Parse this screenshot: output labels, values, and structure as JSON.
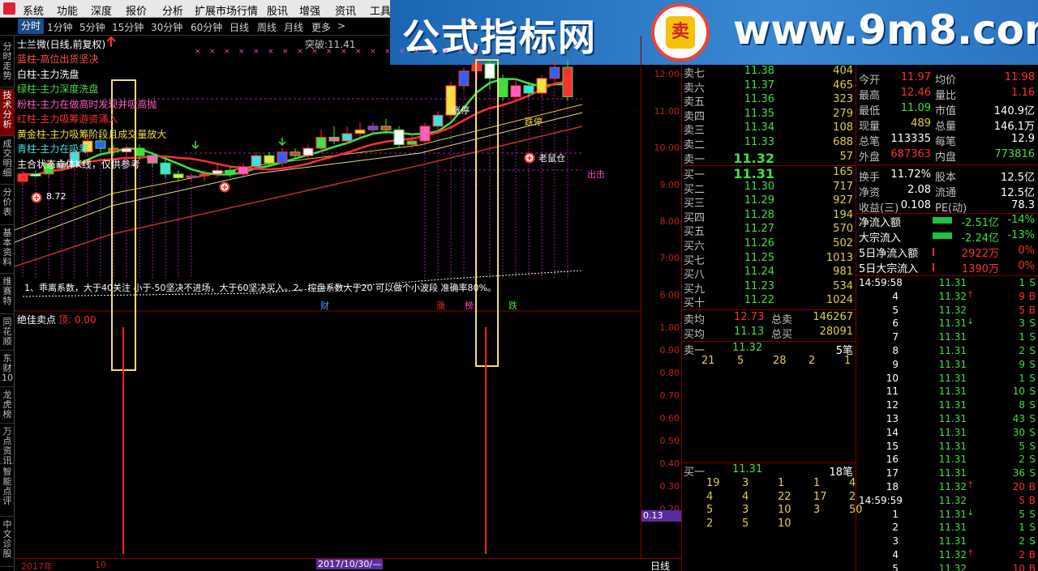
{
  "menu": [
    "系统",
    "功能",
    "深度",
    "报价",
    "分析",
    "扩展市场行情",
    "股讯",
    "增强",
    "资讯",
    "工具"
  ],
  "periods": [
    "分时",
    "1分钟",
    "5分钟",
    "15分钟",
    "30分钟",
    "60分钟",
    "日线",
    "周线",
    "月线",
    "更多"
  ],
  "periods_more_arrow": ">",
  "banner": {
    "name": "公式指标网",
    "url": "www.9m8.com",
    "seal_glyph": "卖"
  },
  "sidetabs": [
    "分时走势",
    "技术分析",
    "成交明细",
    "分价表",
    "基本资料",
    "维赛特",
    "同花顺",
    "东财10",
    "龙虎榜",
    "万点资讯",
    "智能点评",
    "中文诊股"
  ],
  "stock": {
    "title": "士兰微(日线,前复权)",
    "breakout": "突破:11.41"
  },
  "legend": [
    {
      "text": "蓝柱-高位出货坚决",
      "color": "#ff5050"
    },
    {
      "text": "白柱-主力洗盘",
      "color": "#ffffff"
    },
    {
      "text": "绿柱-主力深度洗盘",
      "color": "#40e040"
    },
    {
      "text": "粉柱-主力在做高时发现并吸高抛",
      "color": "#ff60c0"
    },
    {
      "text": "红柱-主力吸筹游资涌入",
      "color": "#ff3030"
    },
    {
      "text": "黄金柱-主力吸筹阶段且成交量放大",
      "color": "#f0e040"
    },
    {
      "text": "青柱-主力在吸筹",
      "color": "#40e0e0"
    },
    {
      "text": "主合状态立体K线，仅供参考",
      "color": "#ffffff"
    }
  ],
  "annotations": {
    "low_price": "8.72",
    "limit_up": "涨停",
    "limit_down": "跌停",
    "rat": "老鼠仓",
    "exit": "出击",
    "note": "1、乖离系数，大于40关注 小于-50坚决不进场，大于60坚决买入。2、控盘系数大于20 可以做个小波段 准确率80%。",
    "events": [
      "财",
      "涨",
      "榜",
      "跌"
    ],
    "sub_title": "绝佳卖点",
    "sub_value": "顶: 0.00",
    "sub_cursor": "0.13"
  },
  "yaxis_main": [
    "12.00",
    "11.00",
    "10.00",
    "9.00",
    "8.00",
    "7.00",
    "6.00"
  ],
  "yaxis_sub": [
    "1.00",
    "0.90",
    "0.80",
    "0.70",
    "0.60",
    "0.50",
    "0.40",
    "0.30",
    "0.20"
  ],
  "bottom": {
    "year": "2017年",
    "month": "10",
    "date": "2017/10/30/—",
    "period_label": "日线"
  },
  "chart_data": {
    "type": "candlestick",
    "title": "士兰微(日线,前复权)",
    "ylim": [
      5.8,
      12.4
    ],
    "candles": [
      [
        9.1,
        9.3,
        9.4,
        9.0
      ],
      [
        9.3,
        9.25,
        9.4,
        9.2
      ],
      [
        9.3,
        9.6,
        9.7,
        9.2
      ],
      [
        9.6,
        9.5,
        9.7,
        9.4
      ],
      [
        9.5,
        9.9,
        10.0,
        9.4
      ],
      [
        9.9,
        10.2,
        10.4,
        9.8
      ],
      [
        10.2,
        10.0,
        10.3,
        9.9
      ],
      [
        10.0,
        9.9,
        10.1,
        9.8
      ],
      [
        9.9,
        10.0,
        10.1,
        9.8
      ],
      [
        10.0,
        9.8,
        10.1,
        9.7
      ],
      [
        9.8,
        9.6,
        9.9,
        9.5
      ],
      [
        9.6,
        9.3,
        9.7,
        9.2
      ],
      [
        9.3,
        9.2,
        9.4,
        9.1
      ],
      [
        9.2,
        9.25,
        9.3,
        9.1
      ],
      [
        9.25,
        9.3,
        9.4,
        9.1
      ],
      [
        9.3,
        9.4,
        9.6,
        9.2
      ],
      [
        9.4,
        9.3,
        9.5,
        9.2
      ],
      [
        9.3,
        9.5,
        9.6,
        9.2
      ],
      [
        9.5,
        9.8,
        9.9,
        9.4
      ],
      [
        9.8,
        9.6,
        9.9,
        9.5
      ],
      [
        9.6,
        9.9,
        10.0,
        9.5
      ],
      [
        9.9,
        9.8,
        10.0,
        9.7
      ],
      [
        9.8,
        10.0,
        10.1,
        9.7
      ],
      [
        10.0,
        10.3,
        10.5,
        9.9
      ],
      [
        10.3,
        10.2,
        10.6,
        10.1
      ],
      [
        10.2,
        10.4,
        10.6,
        10.1
      ],
      [
        10.4,
        10.5,
        10.7,
        10.3
      ],
      [
        10.5,
        10.6,
        10.7,
        10.4
      ],
      [
        10.6,
        10.5,
        10.8,
        10.4
      ],
      [
        10.5,
        10.1,
        10.6,
        10.0
      ],
      [
        10.1,
        10.2,
        10.4,
        10.0
      ],
      [
        10.2,
        10.6,
        10.7,
        10.1
      ],
      [
        10.6,
        10.9,
        11.0,
        10.5
      ],
      [
        10.9,
        11.7,
        11.8,
        10.8
      ],
      [
        11.7,
        12.1,
        12.2,
        11.6
      ],
      [
        12.1,
        12.3,
        12.5,
        11.8
      ],
      [
        12.3,
        11.9,
        12.4,
        11.6
      ],
      [
        11.9,
        11.4,
        12.0,
        11.3
      ],
      [
        11.4,
        11.7,
        11.9,
        11.3
      ],
      [
        11.7,
        11.5,
        11.8,
        11.4
      ],
      [
        11.5,
        11.9,
        12.0,
        11.4
      ],
      [
        11.9,
        12.2,
        12.4,
        11.8
      ],
      [
        12.2,
        11.4,
        12.4,
        11.3
      ]
    ]
  },
  "orderbook": {
    "sell": [
      {
        "label": "卖七",
        "price": "11.38",
        "vol": "404"
      },
      {
        "label": "卖六",
        "price": "11.37",
        "vol": "465"
      },
      {
        "label": "卖五",
        "price": "11.36",
        "vol": "323"
      },
      {
        "label": "卖四",
        "price": "11.35",
        "vol": "279"
      },
      {
        "label": "卖三",
        "price": "11.34",
        "vol": "108"
      },
      {
        "label": "卖二",
        "price": "11.33",
        "vol": "688"
      },
      {
        "label": "卖一",
        "price": "11.32",
        "vol": "57"
      }
    ],
    "buy": [
      {
        "label": "买一",
        "price": "11.31",
        "vol": "165"
      },
      {
        "label": "买二",
        "price": "11.30",
        "vol": "717"
      },
      {
        "label": "买三",
        "price": "11.29",
        "vol": "927"
      },
      {
        "label": "买四",
        "price": "11.28",
        "vol": "194"
      },
      {
        "label": "买五",
        "price": "11.27",
        "vol": "570"
      },
      {
        "label": "买六",
        "price": "11.26",
        "vol": "502"
      },
      {
        "label": "买七",
        "price": "11.25",
        "vol": "1013"
      },
      {
        "label": "买八",
        "price": "11.24",
        "vol": "981"
      },
      {
        "label": "买九",
        "price": "11.23",
        "vol": "534"
      },
      {
        "label": "买十",
        "price": "11.22",
        "vol": "1024"
      }
    ],
    "avg": [
      {
        "l1": "卖均",
        "v1": "12.73",
        "l2": "总卖",
        "v2": "146267"
      },
      {
        "l1": "买均",
        "v1": "11.13",
        "l2": "总买",
        "v2": "28091"
      }
    ],
    "sell1_queue": {
      "label": "卖一",
      "price": "11.32",
      "count": "5笔",
      "orders": [
        "21",
        "5",
        "28",
        "2",
        "1"
      ]
    },
    "buy1_queue": {
      "label": "买一",
      "price": "11.31",
      "count": "18笔",
      "orders": [
        [
          "19",
          "3",
          "1",
          "1",
          "4"
        ],
        [
          "4",
          "4",
          "22",
          "17",
          "2"
        ],
        [
          "5",
          "3",
          "10",
          "3",
          "50"
        ],
        [
          "2",
          "5",
          "10"
        ]
      ]
    }
  },
  "stats": [
    {
      "l1": "今开",
      "v1": "11.97",
      "c1": "red",
      "l2": "均价",
      "v2": "11.98",
      "c2": "red"
    },
    {
      "l1": "最高",
      "v1": "12.46",
      "c1": "red",
      "l2": "量比",
      "v2": "1.16",
      "c2": "red"
    },
    {
      "l1": "最低",
      "v1": "11.09",
      "c1": "green",
      "l2": "市值",
      "v2": "140.9亿",
      "c2": "white"
    },
    {
      "l1": "现量",
      "v1": "489",
      "c1": "yellow",
      "l2": "总量",
      "v2": "146.1万",
      "c2": "white"
    },
    {
      "l1": "总笔",
      "v1": "113335",
      "c1": "white",
      "l2": "每笔",
      "v2": "12.9",
      "c2": "white"
    },
    {
      "l1": "外盘",
      "v1": "687363",
      "c1": "red",
      "l2": "内盘",
      "v2": "773816",
      "c2": "green"
    },
    {
      "l1": "换手",
      "v1": "11.72%",
      "c1": "white",
      "l2": "股本",
      "v2": "12.5亿",
      "c2": "white"
    },
    {
      "l1": "净资",
      "v1": "2.08",
      "c1": "white",
      "l2": "流通",
      "v2": "12.5亿",
      "c2": "white"
    },
    {
      "l1": "收益(三)",
      "v1": "0.108",
      "c1": "white",
      "l2": "PE(动)",
      "v2": "78.3",
      "c2": "white"
    }
  ],
  "flows": [
    {
      "label": "净流入额",
      "value": "-2.51亿",
      "pct": "-14%"
    },
    {
      "label": "大宗流入",
      "value": "-2.24亿",
      "pct": "-13%"
    },
    {
      "label": "5日净流入额",
      "value": "2922万",
      "pct": "0%"
    },
    {
      "label": "5日大宗流入",
      "value": "1390万",
      "pct": "0%"
    }
  ],
  "ticks": [
    {
      "t": "14:59:58",
      "p": "11.31",
      "v": "1",
      "s": "S",
      "pc": "green",
      "vc": "green"
    },
    {
      "t": "4",
      "p": "11.32",
      "v": "9",
      "s": "B",
      "pc": "green",
      "vc": "red",
      "arr": "up"
    },
    {
      "t": "5",
      "p": "11.32",
      "v": "5",
      "s": "B",
      "pc": "green",
      "vc": "red"
    },
    {
      "t": "6",
      "p": "11.31",
      "v": "3",
      "s": "S",
      "pc": "green",
      "vc": "green",
      "arr": "down"
    },
    {
      "t": "7",
      "p": "11.31",
      "v": "1",
      "s": "S",
      "pc": "green",
      "vc": "green"
    },
    {
      "t": "8",
      "p": "11.31",
      "v": "2",
      "s": "S",
      "pc": "green",
      "vc": "green"
    },
    {
      "t": "9",
      "p": "11.31",
      "v": "9",
      "s": "S",
      "pc": "green",
      "vc": "green"
    },
    {
      "t": "10",
      "p": "11.31",
      "v": "1",
      "s": "S",
      "pc": "green",
      "vc": "green"
    },
    {
      "t": "11",
      "p": "11.31",
      "v": "10",
      "s": "S",
      "pc": "green",
      "vc": "green"
    },
    {
      "t": "12",
      "p": "11.31",
      "v": "8",
      "s": "S",
      "pc": "green",
      "vc": "green"
    },
    {
      "t": "13",
      "p": "11.31",
      "v": "43",
      "s": "S",
      "pc": "green",
      "vc": "green"
    },
    {
      "t": "14",
      "p": "11.31",
      "v": "30",
      "s": "S",
      "pc": "green",
      "vc": "green"
    },
    {
      "t": "15",
      "p": "11.31",
      "v": "5",
      "s": "S",
      "pc": "green",
      "vc": "green"
    },
    {
      "t": "16",
      "p": "11.31",
      "v": "2",
      "s": "S",
      "pc": "green",
      "vc": "green"
    },
    {
      "t": "17",
      "p": "11.31",
      "v": "36",
      "s": "S",
      "pc": "green",
      "vc": "green"
    },
    {
      "t": "18",
      "p": "11.32",
      "v": "20",
      "s": "B",
      "pc": "green",
      "vc": "red",
      "arr": "up"
    },
    {
      "t": "14:59:59",
      "p": "11.32",
      "v": "5",
      "s": "B",
      "pc": "green",
      "vc": "red"
    },
    {
      "t": "1",
      "p": "11.31",
      "v": "5",
      "s": "S",
      "pc": "green",
      "vc": "green",
      "arr": "down"
    },
    {
      "t": "2",
      "p": "11.31",
      "v": "1",
      "s": "S",
      "pc": "green",
      "vc": "green"
    },
    {
      "t": "3",
      "p": "11.31",
      "v": "2",
      "s": "S",
      "pc": "green",
      "vc": "green"
    },
    {
      "t": "4",
      "p": "11.32",
      "v": "2",
      "s": "B",
      "pc": "green",
      "vc": "red",
      "arr": "up"
    },
    {
      "t": "5",
      "p": "11.32",
      "v": "10",
      "s": "B",
      "pc": "green",
      "vc": "red"
    }
  ]
}
